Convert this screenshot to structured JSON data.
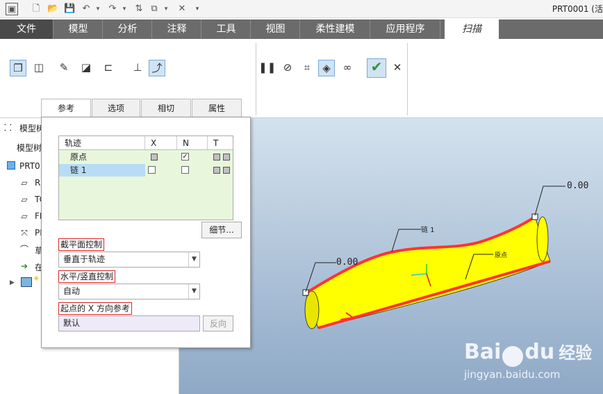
{
  "window": {
    "title": "PRT0001 (活"
  },
  "quick_access": [
    "new",
    "open",
    "save",
    "undo",
    "redo",
    "regenerate",
    "windows",
    "close",
    "customize"
  ],
  "ribbon_tabs": [
    "文件",
    "模型",
    "分析",
    "注释",
    "工具",
    "视图",
    "柔性建模",
    "应用程序",
    "扫描"
  ],
  "dashboard_tabs": [
    "参考",
    "选项",
    "相切",
    "属性"
  ],
  "tree": {
    "header": "模型树",
    "subheader": "模型树",
    "root": "PRT0",
    "items": [
      "R",
      "TC",
      "FR",
      "PI",
      "草",
      "在"
    ]
  },
  "references": {
    "columns": [
      "轨迹",
      "X",
      "N",
      "T"
    ],
    "rows": [
      {
        "name": "原点",
        "x_checked": "grey",
        "n_checked": "✓",
        "t": "grey"
      },
      {
        "name": "链 1",
        "x_checked": "",
        "n_checked": "",
        "t": "grey"
      }
    ],
    "details_button": "细节...",
    "section_plane_label": "截平面控制",
    "section_plane_value": "垂直于轨迹",
    "hv_label": "水平/竖直控制",
    "hv_value": "自动",
    "xdir_label": "起点的 X 方向参考",
    "xdir_value": "默认",
    "flip_button": "反向"
  },
  "graphics": {
    "dim_top": "0.00",
    "dim_left": "0.00",
    "chain_label": "链 1",
    "origin_label": "原点"
  },
  "watermark": {
    "brand": "Bai",
    "brand2": "du",
    "cn": "经验",
    "url": "jingyan.baidu.com"
  },
  "colors": {
    "accent_tab_bg": "#6b6b6b",
    "selected_row": "#b8dcf5",
    "table_bg": "#e8f7dc",
    "sweep_fill": "#ffff00",
    "trajectory": "#ff3333"
  }
}
